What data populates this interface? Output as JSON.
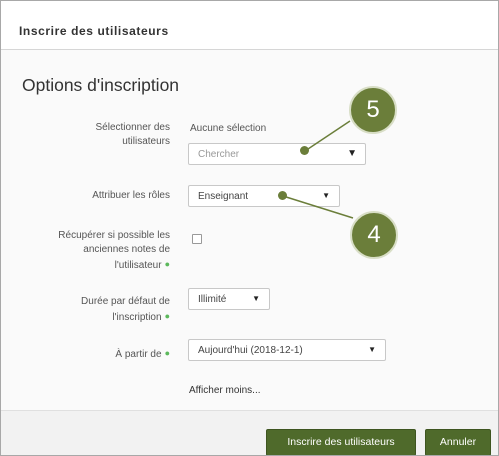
{
  "dialog": {
    "title": "Inscrire des utilisateurs"
  },
  "section": {
    "title": "Options d'inscription"
  },
  "form": {
    "select_users": {
      "label_line1": "Sélectionner des",
      "label_line2": "utilisateurs",
      "selection_text": "Aucune sélection",
      "placeholder": "Chercher"
    },
    "roles": {
      "label": "Attribuer les rôles",
      "value": "Enseignant"
    },
    "recover_grades": {
      "label_line1": "Récupérer si possible les",
      "label_line2": "anciennes notes de",
      "label_line3": "l'utilisateur",
      "checked": false
    },
    "duration": {
      "label_line1": "Durée par défaut de",
      "label_line2": "l'inscription",
      "value": "Illimité"
    },
    "start": {
      "label": "À partir de",
      "value": "Aujourd'hui (2018-12-1)"
    },
    "show_less": "Afficher moins..."
  },
  "footer": {
    "submit_label": "Inscrire des utilisateurs",
    "cancel_label": "Annuler"
  },
  "callouts": {
    "five": "5",
    "four": "4"
  },
  "colors": {
    "primary_button": "#4f6a2b",
    "callout": "#6b7e3a",
    "required_dot": "#5cb85c"
  },
  "icons": {
    "caret": "caret-down-icon",
    "required": "required-icon"
  }
}
